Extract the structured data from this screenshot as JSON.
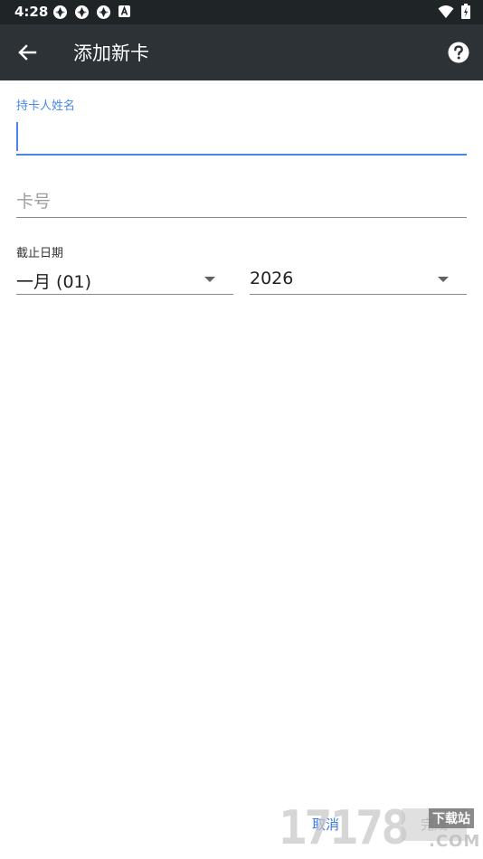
{
  "status_bar": {
    "time": "4:28",
    "left_icons": [
      "sync-icon",
      "sync-icon",
      "sync-icon",
      "a-notification-icon"
    ],
    "right_icons": [
      "wifi-icon",
      "battery-icon"
    ]
  },
  "app_bar": {
    "title": "添加新卡",
    "back_icon": "arrow-back-icon",
    "help_icon": "help-circle-icon"
  },
  "form": {
    "name_label": "持卡人姓名",
    "name_value": "",
    "number_placeholder": "卡号",
    "number_value": "",
    "expiry_label": "截止日期",
    "month_value": "一月 (01)",
    "year_value": "2026"
  },
  "actions": {
    "cancel_label": "取消",
    "confirm_label": "完成"
  },
  "watermark": {
    "digits": "17178",
    "site": "下载站",
    "com": ".COM"
  },
  "colors": {
    "status_bar": "#1f2427",
    "app_bar": "#2c3236",
    "accent": "#4a86e8",
    "button_text": "#3b78e7"
  }
}
